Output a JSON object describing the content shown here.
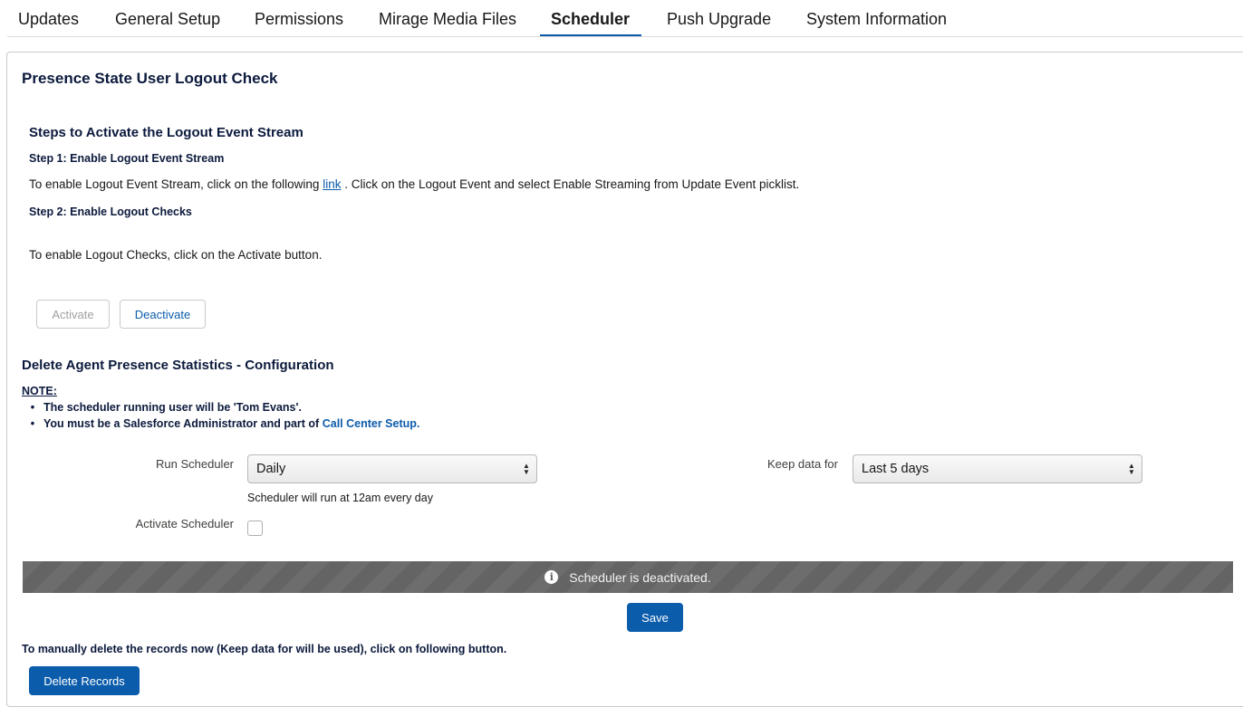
{
  "tabs": [
    {
      "label": "Updates"
    },
    {
      "label": "General Setup"
    },
    {
      "label": "Permissions"
    },
    {
      "label": "Mirage Media Files"
    },
    {
      "label": "Scheduler"
    },
    {
      "label": "Push Upgrade"
    },
    {
      "label": "System Information"
    }
  ],
  "active_tab": "Scheduler",
  "logout_check": {
    "title": "Presence State User Logout Check",
    "steps_heading": "Steps to Activate the Logout Event Stream",
    "step1_title": "Step 1: Enable Logout Event Stream",
    "step1_text_before": "To enable Logout Event Stream, click on the following",
    "step1_link": "link",
    "step1_text_after": ". Click on the Logout Event and select Enable Streaming from Update Event picklist.",
    "step2_title": "Step 2: Enable Logout Checks",
    "step2_text": "To enable Logout Checks, click on the Activate button.",
    "activate_label": "Activate",
    "deactivate_label": "Deactivate"
  },
  "delete_config": {
    "title": "Delete Agent Presence Statistics - Configuration",
    "note_label": "NOTE:",
    "note_item1": "The scheduler running user will be 'Tom Evans'.",
    "note_item2_before": "You must be a Salesforce Administrator and part of",
    "note_item2_link": "Call Center Setup.",
    "run_scheduler_label": "Run Scheduler",
    "run_scheduler_value": "Daily",
    "run_scheduler_help": "Scheduler will run at 12am every day",
    "keep_data_label": "Keep data for",
    "keep_data_value": "Last 5 days",
    "activate_scheduler_label": "Activate Scheduler",
    "activate_scheduler_checked": false,
    "status_message": "Scheduler is deactivated.",
    "save_label": "Save",
    "manual_delete_text": "To manually delete the records now (Keep data for will be used), click on following button.",
    "delete_records_label": "Delete Records"
  },
  "colors": {
    "brand": "#0b5cab",
    "heading": "#0c1a3d",
    "status_bar": "#646464"
  }
}
